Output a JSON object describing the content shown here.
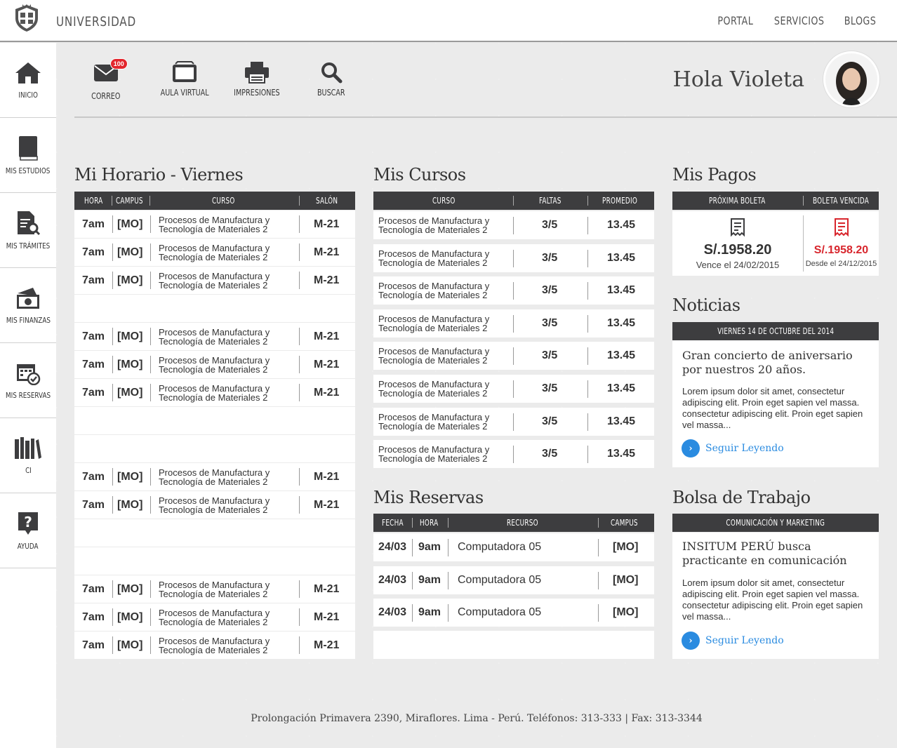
{
  "brand": "UNIVERSIDAD",
  "topnav": [
    "PORTAL",
    "SERVICIOS",
    "BLOGS"
  ],
  "sidebar": [
    {
      "label": "INICIO",
      "icon": "home-icon"
    },
    {
      "label": "MIS ESTUDIOS",
      "icon": "book-icon"
    },
    {
      "label": "MIS TRÁMITES",
      "icon": "document-search-icon"
    },
    {
      "label": "MIS FINANZAS",
      "icon": "money-icon"
    },
    {
      "label": "MIS RESERVAS",
      "icon": "calendar-check-icon"
    },
    {
      "label": "CI",
      "icon": "library-icon"
    },
    {
      "label": "AYUDA",
      "icon": "help-icon"
    }
  ],
  "quick": [
    {
      "label": "CORREO",
      "icon": "mail-icon",
      "badge": "100"
    },
    {
      "label": "AULA VIRTUAL",
      "icon": "monitor-icon"
    },
    {
      "label": "IMPRESIONES",
      "icon": "printer-icon"
    },
    {
      "label": "BUSCAR",
      "icon": "search-icon"
    }
  ],
  "greeting": "Hola Violeta",
  "schedule": {
    "title": "Mi Horario - Viernes",
    "headers": [
      "HORA",
      "CAMPUS",
      "CURSO",
      "SALÓN"
    ],
    "rows": [
      {
        "hora": "7am",
        "campus": "[MO]",
        "curso": "Procesos de Manufactura y Tecnología de Materiales 2",
        "salon": "M-21"
      },
      {
        "hora": "7am",
        "campus": "[MO]",
        "curso": "Procesos de Manufactura y Tecnología de Materiales 2",
        "salon": "M-21"
      },
      {
        "hora": "7am",
        "campus": "[MO]",
        "curso": "Procesos de Manufactura y Tecnología de Materiales 2",
        "salon": "M-21"
      },
      null,
      {
        "hora": "7am",
        "campus": "[MO]",
        "curso": "Procesos de Manufactura y Tecnología de Materiales 2",
        "salon": "M-21"
      },
      {
        "hora": "7am",
        "campus": "[MO]",
        "curso": "Procesos de Manufactura y Tecnología de Materiales 2",
        "salon": "M-21"
      },
      {
        "hora": "7am",
        "campus": "[MO]",
        "curso": "Procesos de Manufactura y Tecnología de Materiales 2",
        "salon": "M-21"
      },
      null,
      null,
      {
        "hora": "7am",
        "campus": "[MO]",
        "curso": "Procesos de Manufactura y Tecnología de Materiales 2",
        "salon": "M-21"
      },
      {
        "hora": "7am",
        "campus": "[MO]",
        "curso": "Procesos de Manufactura y Tecnología de Materiales 2",
        "salon": "M-21"
      },
      null,
      null,
      {
        "hora": "7am",
        "campus": "[MO]",
        "curso": "Procesos de Manufactura y Tecnología de Materiales 2",
        "salon": "M-21"
      },
      {
        "hora": "7am",
        "campus": "[MO]",
        "curso": "Procesos de Manufactura y Tecnología de Materiales 2",
        "salon": "M-21"
      },
      {
        "hora": "7am",
        "campus": "[MO]",
        "curso": "Procesos de Manufactura y Tecnología de Materiales 2",
        "salon": "M-21"
      }
    ]
  },
  "courses": {
    "title": "Mis Cursos",
    "headers": [
      "CURSO",
      "FALTAS",
      "PROMEDIO"
    ],
    "rows": [
      {
        "curso": "Procesos de Manufactura y Tecnología de Materiales 2",
        "faltas": "3/5",
        "promedio": "13.45"
      },
      {
        "curso": "Procesos de Manufactura y Tecnología de Materiales 2",
        "faltas": "3/5",
        "promedio": "13.45"
      },
      {
        "curso": "Procesos de Manufactura y Tecnología de Materiales 2",
        "faltas": "3/5",
        "promedio": "13.45"
      },
      {
        "curso": "Procesos de Manufactura y Tecnología de Materiales 2",
        "faltas": "3/5",
        "promedio": "13.45"
      },
      {
        "curso": "Procesos de Manufactura y Tecnología de Materiales 2",
        "faltas": "3/5",
        "promedio": "13.45"
      },
      {
        "curso": "Procesos de Manufactura y Tecnología de Materiales 2",
        "faltas": "3/5",
        "promedio": "13.45"
      },
      {
        "curso": "Procesos de Manufactura y Tecnología de Materiales 2",
        "faltas": "3/5",
        "promedio": "13.45"
      },
      {
        "curso": "Procesos de Manufactura y Tecnología de Materiales 2",
        "faltas": "3/5",
        "promedio": "13.45"
      }
    ]
  },
  "reservas": {
    "title": "Mis Reservas",
    "headers": [
      "FECHA",
      "HORA",
      "RECURSO",
      "CAMPUS"
    ],
    "rows": [
      {
        "fecha": "24/03",
        "hora": "9am",
        "recurso": "Computadora 05",
        "campus": "[MO]"
      },
      {
        "fecha": "24/03",
        "hora": "9am",
        "recurso": "Computadora 05",
        "campus": "[MO]"
      },
      {
        "fecha": "24/03",
        "hora": "9am",
        "recurso": "Computadora 05",
        "campus": "[MO]"
      }
    ]
  },
  "pagos": {
    "title": "Mis Pagos",
    "headers": [
      "PRÓXIMA BOLETA",
      "BOLETA VENCIDA"
    ],
    "proxima": {
      "amount": "S/.1958.20",
      "note": "Vence el 24/02/2015"
    },
    "vencida": {
      "amount": "S/.1958.20",
      "note": "Desde el 24/12/2015"
    },
    "alert_color": "#d8262d"
  },
  "noticias": {
    "title": "Noticias",
    "header": "VIERNES 14 DE OCTUBRE DEL 2014",
    "headline": "Gran concierto de aniversario por nuestros 20 años.",
    "body": "Lorem ipsum dolor sit amet, consectetur adipiscing elit. Proin eget sapien vel massa. consectetur adipiscing elit. Proin eget sapien vel massa...",
    "link": "Seguir Leyendo"
  },
  "bolsa": {
    "title": "Bolsa de Trabajo",
    "header": "COMUNICACIÓN Y MARKETING",
    "headline": "INSITUM PERÚ busca practicante en comunicación",
    "body": "Lorem ipsum dolor sit amet, consectetur adipiscing elit. Proin eget sapien vel massa. consectetur adipiscing elit. Proin eget sapien vel massa...",
    "link": "Seguir Leyendo"
  },
  "footer": "Prolongación Primavera 2390, Miraflores. Lima - Perú. Teléfonos: 313-333 | Fax: 313-3344",
  "colors": {
    "accent": "#2a8be0",
    "header_bg": "#3d3d3f",
    "badge": "#e3262d"
  }
}
